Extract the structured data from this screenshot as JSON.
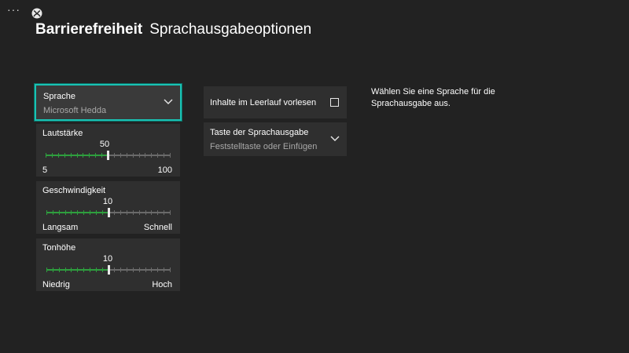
{
  "top": {
    "more_glyph": "···",
    "section": "Barrierefreiheit",
    "page": "Sprachausgabeoptionen"
  },
  "voice": {
    "label": "Sprache",
    "value": "Microsoft Hedda"
  },
  "volume": {
    "label": "Lautstärke",
    "value": "50",
    "min_label": "5",
    "max_label": "100",
    "level": 0.5
  },
  "speed": {
    "label": "Geschwindigkeit",
    "value": "10",
    "min_label": "Langsam",
    "max_label": "Schnell",
    "level": 0.5
  },
  "pitch": {
    "label": "Tonhöhe",
    "value": "10",
    "min_label": "Niedrig",
    "max_label": "Hoch",
    "level": 0.5
  },
  "idle_read": {
    "label": "Inhalte im Leerlauf vorlesen",
    "checked": false
  },
  "hotkey": {
    "label": "Taste der Sprachausgabe",
    "value": "Feststelltaste oder Einfügen"
  },
  "help": {
    "text": "Wählen Sie eine Sprache für die Sprachausgabe aus."
  },
  "colors": {
    "accent_focus": "#19c3b4",
    "slider_fill": "#2e9e3e",
    "background": "#222222",
    "tile": "#2f2f2f"
  }
}
